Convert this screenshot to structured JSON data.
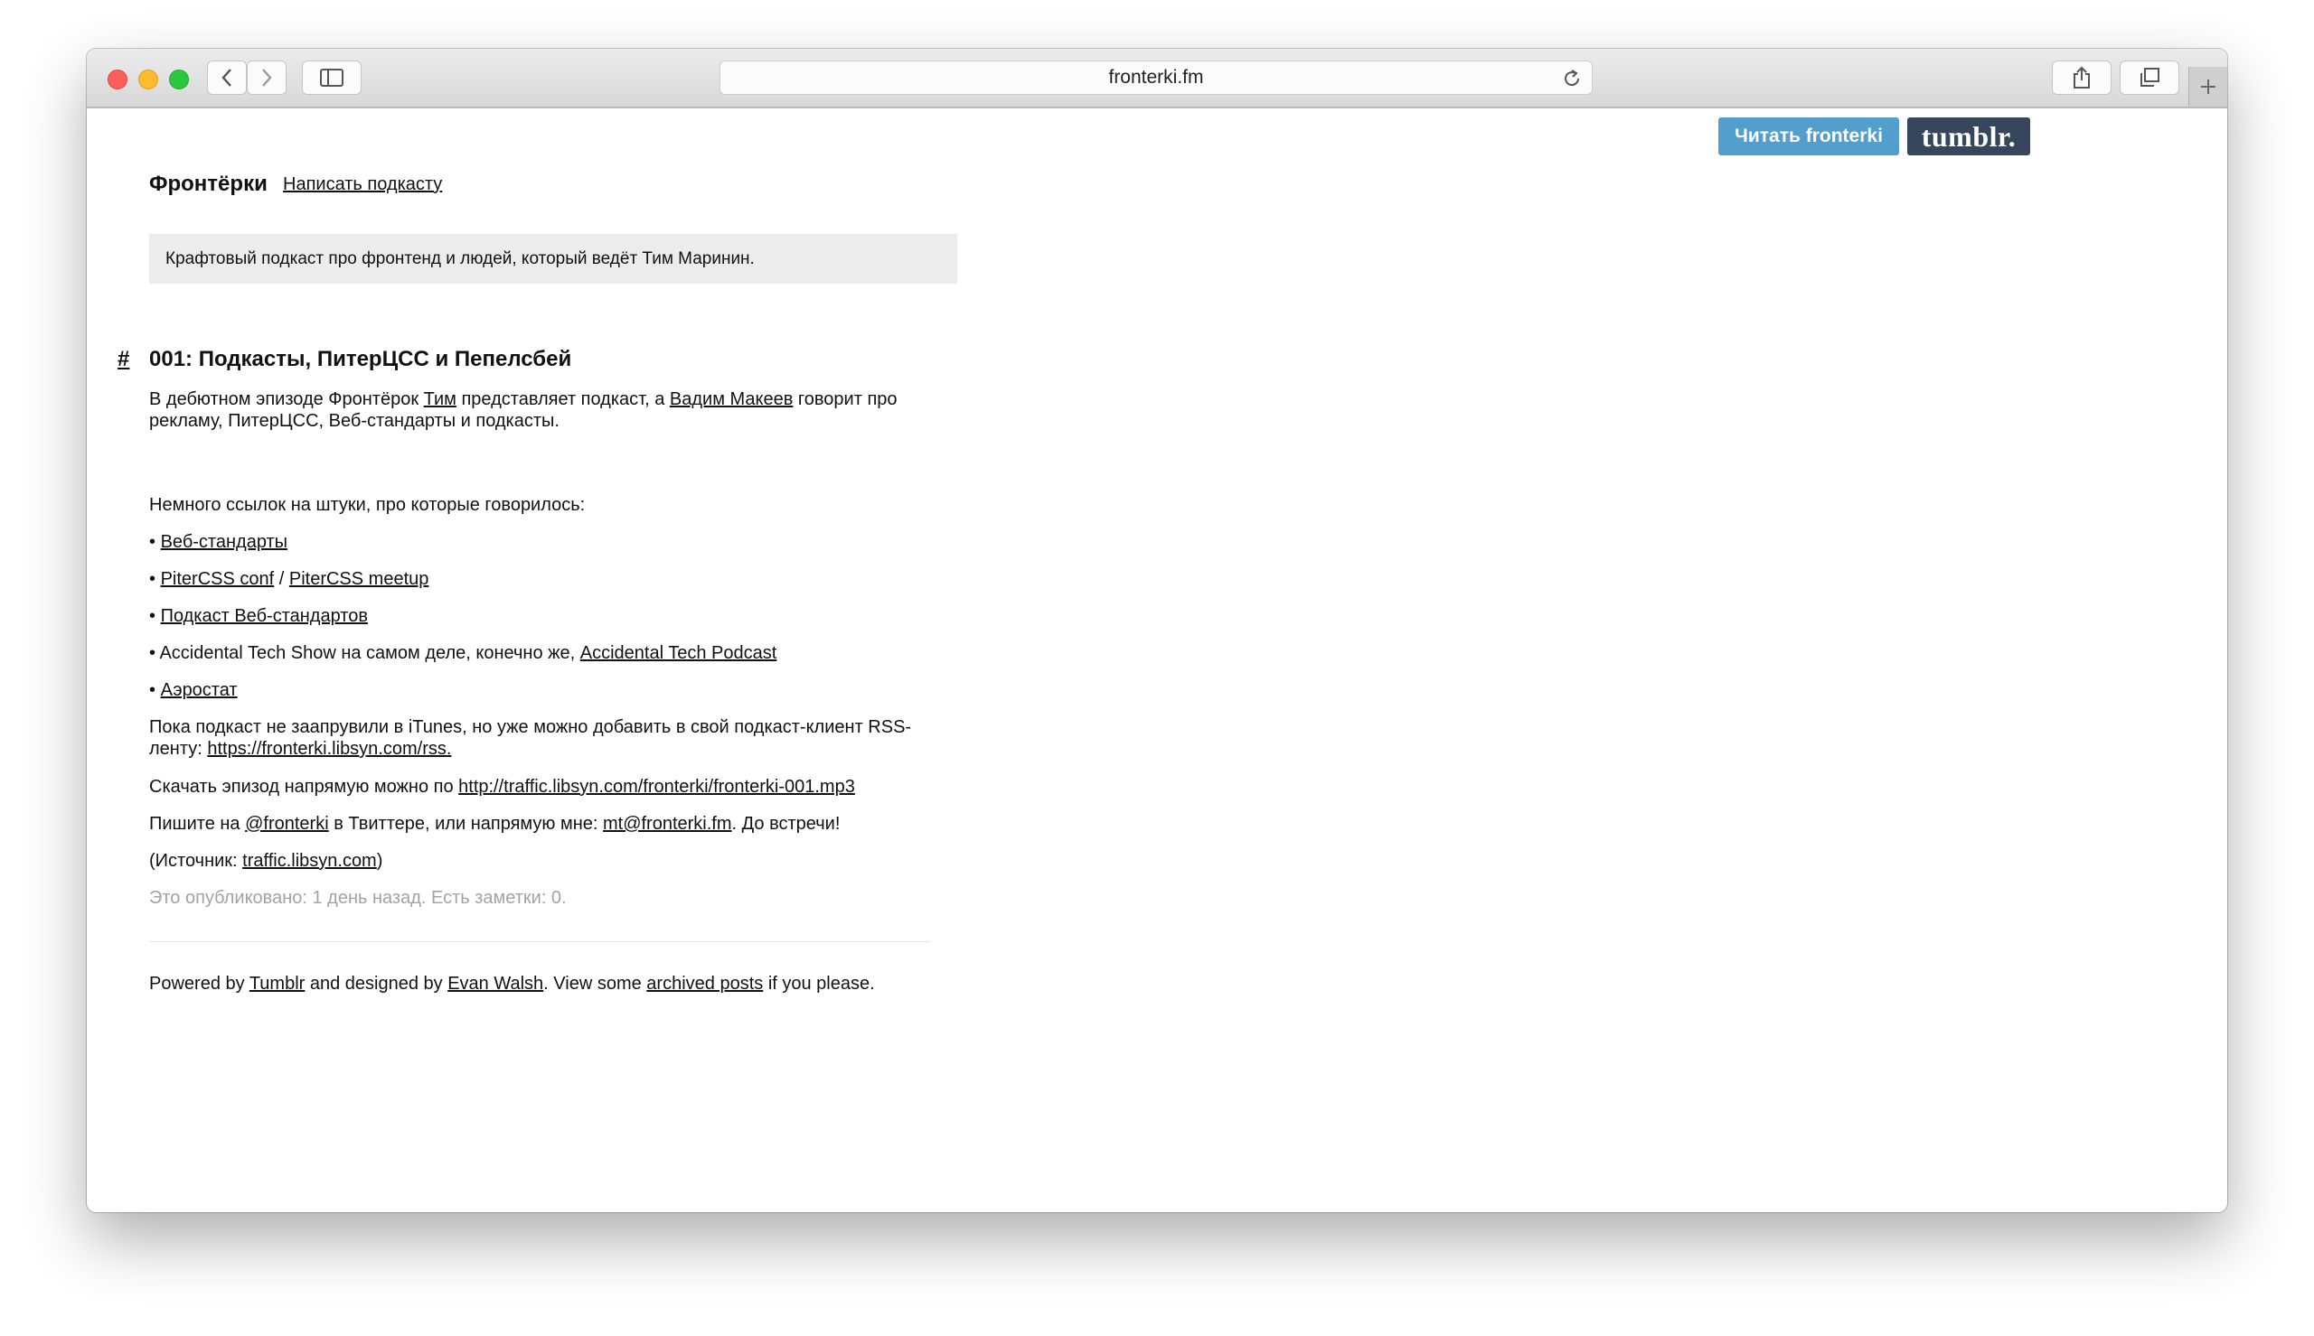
{
  "browser": {
    "address": "fronterki.fm"
  },
  "tumblr_controls": {
    "read_button": "Читать fronterki",
    "logo": "tumblr."
  },
  "header": {
    "blog_title": "Фронтёрки",
    "nav_link": "Написать подкасту",
    "description": "Крафтовый подкаст про фронтенд и людей, который ведёт Тим Маринин."
  },
  "post": {
    "permalink": "#",
    "title": "001: Подкасты, ПитерЦСС и Пепелсбей",
    "intro": {
      "t1": "В дебютном эпизоде Фронтёрок ",
      "link1": "Тим",
      "t2": " представляет подкаст, а ",
      "link2": "Вадим Макеев",
      "t3": " говорит про рекламу, ПитерЦСС, Веб-стандарты и подкасты."
    },
    "links_intro": "Немного ссылок на штуки, про которые говорилось:",
    "bullet": "•",
    "items": {
      "i1_link": "Веб-стандарты",
      "i2_link1": "PiterCSS conf",
      "i2_sep": " / ",
      "i2_link2": "PiterCSS meetup",
      "i3_link": "Подкаст Веб-стандартов",
      "i4_text": "Accidental Tech Show на самом деле, конечно же, ",
      "i4_link": "Accidental Tech Podcast",
      "i5_link": "Аэростат"
    },
    "itunes": {
      "text": "Пока подкаст не заапрувили в iTunes, но уже можно добавить в свой подкаст-клиент RSS-ленту: ",
      "link": "https://fronterki.libsyn.com/rss."
    },
    "download": {
      "text": "Скачать эпизод напрямую можно по ",
      "link": "http://traffic.libsyn.com/fronterki/fronterki-001.mp3"
    },
    "contact": {
      "t1": "Пишите на ",
      "link1": "@fronterki",
      "t2": " в Твиттере, или напрямую мне: ",
      "link2": "mt@fronterki.fm",
      "t3": ". До встречи!"
    },
    "source": {
      "t1": "(Источник: ",
      "link": "traffic.libsyn.com",
      "t2": ")"
    },
    "meta": "Это опубликовано: 1 день назад. Есть заметки: 0."
  },
  "footer": {
    "t1": "Powered by ",
    "link1": "Tumblr",
    "t2": " and designed by ",
    "link2": "Evan Walsh",
    "t3": ". View some ",
    "link3": "archived posts",
    "t4": " if you please."
  }
}
